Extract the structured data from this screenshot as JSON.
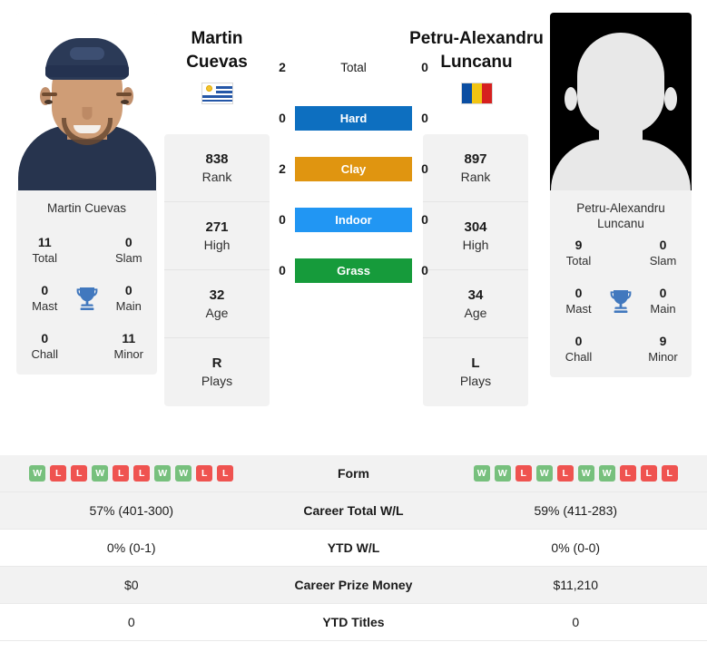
{
  "players": {
    "left": {
      "first_name": "Martin",
      "last_name": "Cuevas",
      "full_name": "Martin Cuevas",
      "country_flag": "uruguay-flag",
      "photo": "player-photo",
      "titles": {
        "total_value": "11",
        "total_label": "Total",
        "slam_value": "0",
        "slam_label": "Slam",
        "mast_value": "0",
        "mast_label": "Mast",
        "main_value": "0",
        "main_label": "Main",
        "chall_value": "0",
        "chall_label": "Chall",
        "minor_value": "11",
        "minor_label": "Minor",
        "trophy_icon": "trophy-icon"
      },
      "stats": [
        {
          "value": "838",
          "label": "Rank"
        },
        {
          "value": "271",
          "label": "High"
        },
        {
          "value": "32",
          "label": "Age"
        },
        {
          "value": "R",
          "label": "Plays"
        }
      ],
      "form": [
        "W",
        "L",
        "L",
        "W",
        "L",
        "L",
        "W",
        "W",
        "L",
        "L"
      ],
      "career_total_wl": "57% (401-300)",
      "ytd_wl": "0% (0-1)",
      "career_prize_money": "$0",
      "ytd_titles": "0"
    },
    "right": {
      "first_name": "Petru-Alexandru",
      "last_name": "Luncanu",
      "full_name": "Petru-Alexandru Luncanu",
      "country_flag": "romania-flag",
      "photo": "player-photo-placeholder",
      "titles": {
        "total_value": "9",
        "total_label": "Total",
        "slam_value": "0",
        "slam_label": "Slam",
        "mast_value": "0",
        "mast_label": "Mast",
        "main_value": "0",
        "main_label": "Main",
        "chall_value": "0",
        "chall_label": "Chall",
        "minor_value": "9",
        "minor_label": "Minor",
        "trophy_icon": "trophy-icon"
      },
      "stats": [
        {
          "value": "897",
          "label": "Rank"
        },
        {
          "value": "304",
          "label": "High"
        },
        {
          "value": "34",
          "label": "Age"
        },
        {
          "value": "L",
          "label": "Plays"
        }
      ],
      "form": [
        "W",
        "W",
        "L",
        "W",
        "L",
        "W",
        "W",
        "L",
        "L",
        "L"
      ],
      "career_total_wl": "59% (411-283)",
      "ytd_wl": "0% (0-0)",
      "career_prize_money": "$11,210",
      "ytd_titles": "0"
    }
  },
  "head_to_head": [
    {
      "label": "Total",
      "left": "2",
      "right": "0",
      "color": ""
    },
    {
      "label": "Hard",
      "left": "0",
      "right": "0",
      "color": "#0d6fc0"
    },
    {
      "label": "Clay",
      "left": "2",
      "right": "0",
      "color": "#e09510"
    },
    {
      "label": "Indoor",
      "left": "0",
      "right": "0",
      "color": "#2196f3"
    },
    {
      "label": "Grass",
      "left": "0",
      "right": "0",
      "color": "#169b3b"
    }
  ],
  "comparison_rows": [
    {
      "label": "Form"
    },
    {
      "label": "Career Total W/L"
    },
    {
      "label": "YTD W/L"
    },
    {
      "label": "Career Prize Money"
    },
    {
      "label": "YTD Titles"
    }
  ],
  "colors": {
    "card_bg": "#f2f2f2",
    "win_badge": "#77c07d",
    "loss_badge": "#ef5350",
    "trophy": "#4178be"
  }
}
